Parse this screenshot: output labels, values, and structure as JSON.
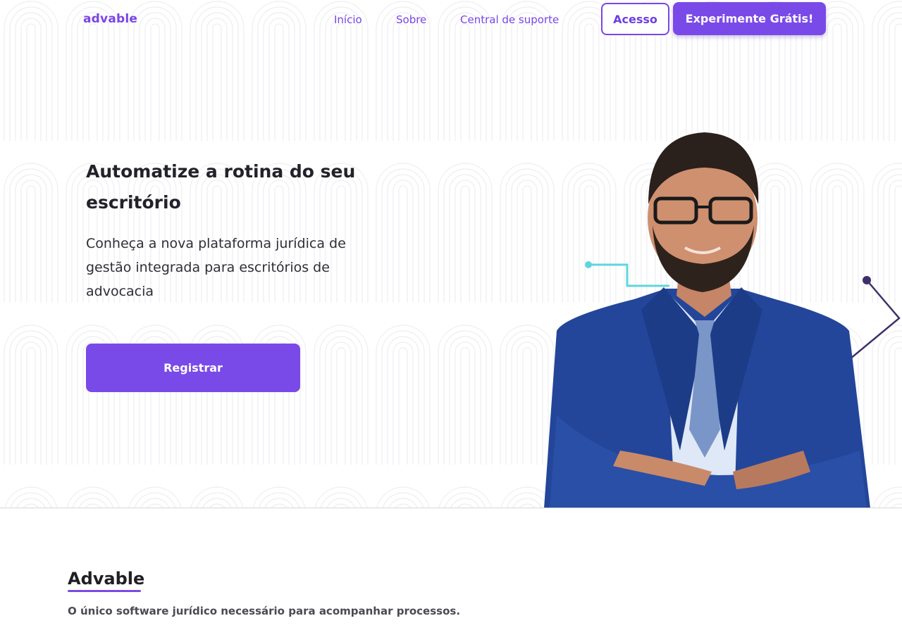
{
  "brand": {
    "name": "advable",
    "accent": "#7a4ae8"
  },
  "nav": {
    "links": [
      "Início",
      "Sobre",
      "Central de suporte"
    ],
    "login_label": "Acesso",
    "trial_label": "Experimente Grátis!"
  },
  "hero": {
    "title": "Automatize a rotina do seu escritório",
    "subtitle": "Conheça a nova plataforma jurídica de gestão integrada para escritórios de advocacia",
    "cta_label": "Registrar",
    "image": "professional-man-in-suit-photo"
  },
  "about": {
    "title": "Advable",
    "tagline": "O único software jurídico necessário para acompanhar processos."
  }
}
